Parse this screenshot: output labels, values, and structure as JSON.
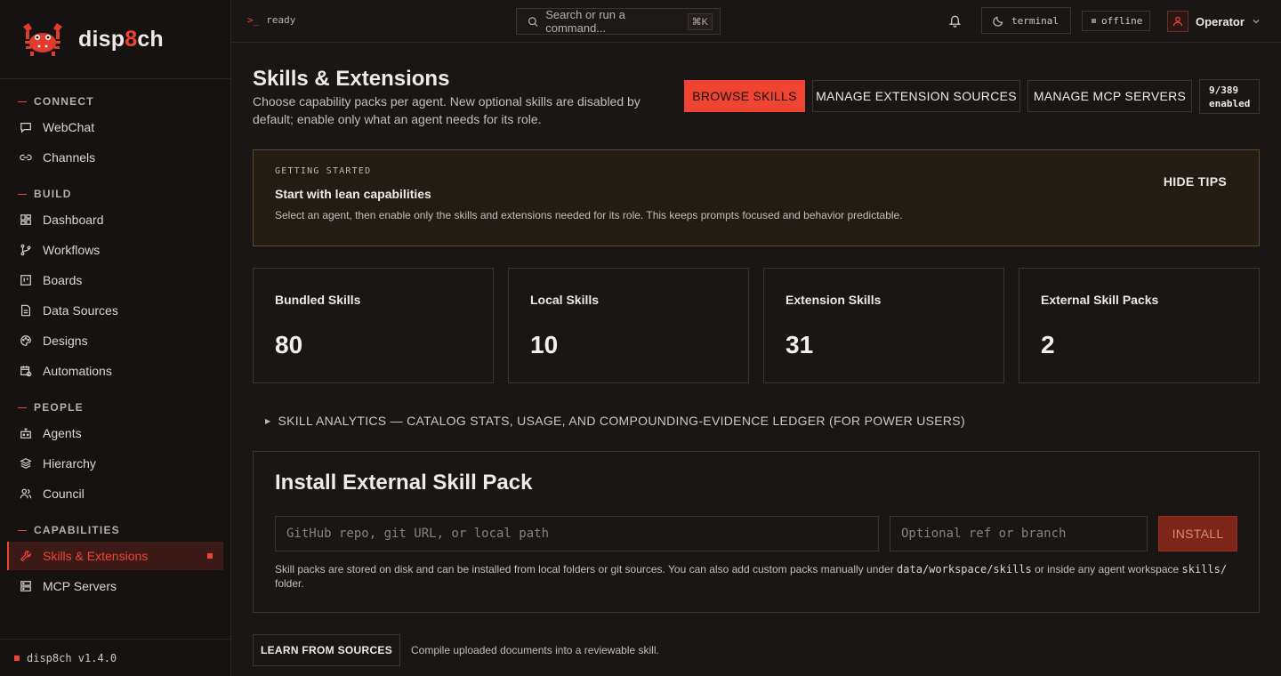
{
  "brand": {
    "name_prefix": "disp",
    "name_accent": "8",
    "name_suffix": "ch",
    "version": "disp8ch v1.4.0"
  },
  "sidebar": {
    "sections": [
      {
        "label": "CONNECT",
        "items": [
          {
            "label": "WebChat",
            "icon": "chat-icon"
          },
          {
            "label": "Channels",
            "icon": "link-icon"
          }
        ]
      },
      {
        "label": "BUILD",
        "items": [
          {
            "label": "Dashboard",
            "icon": "grid-icon"
          },
          {
            "label": "Workflows",
            "icon": "branch-icon"
          },
          {
            "label": "Boards",
            "icon": "board-icon"
          },
          {
            "label": "Data Sources",
            "icon": "file-icon"
          },
          {
            "label": "Designs",
            "icon": "palette-icon"
          },
          {
            "label": "Automations",
            "icon": "calendar-clock-icon"
          }
        ]
      },
      {
        "label": "PEOPLE",
        "items": [
          {
            "label": "Agents",
            "icon": "robot-icon"
          },
          {
            "label": "Hierarchy",
            "icon": "layers-icon"
          },
          {
            "label": "Council",
            "icon": "users-icon"
          }
        ]
      },
      {
        "label": "CAPABILITIES",
        "items": [
          {
            "label": "Skills & Extensions",
            "icon": "wrench-icon",
            "active": true
          },
          {
            "label": "MCP Servers",
            "icon": "server-icon"
          }
        ]
      }
    ]
  },
  "topbar": {
    "status": "ready",
    "search_placeholder": "Search or run a command...",
    "search_shortcut": "⌘K",
    "theme_label": "terminal",
    "connection_label": "offline",
    "user_name": "Operator"
  },
  "page": {
    "title": "Skills & Extensions",
    "subtitle": "Choose capability packs per agent. New optional skills are disabled by default; enable only what an agent needs for its role.",
    "actions": {
      "browse": "BROWSE SKILLS",
      "manage_sources": "MANAGE EXTENSION SOURCES",
      "manage_mcp": "MANAGE MCP SERVERS"
    },
    "enabled_count_top": "9/389",
    "enabled_count_bottom": "enabled"
  },
  "tips": {
    "kicker": "GETTING STARTED",
    "title": "Start with lean capabilities",
    "body": "Select an agent, then enable only the skills and extensions needed for its role. This keeps prompts focused and behavior predictable.",
    "hide_label": "HIDE TIPS"
  },
  "stats": [
    {
      "label": "Bundled Skills",
      "value": "80"
    },
    {
      "label": "Local Skills",
      "value": "10"
    },
    {
      "label": "Extension Skills",
      "value": "31"
    },
    {
      "label": "External Skill Packs",
      "value": "2"
    }
  ],
  "analytics_toggle": "SKILL ANALYTICS — CATALOG STATS, USAGE, AND COMPOUNDING-EVIDENCE LEDGER (FOR POWER USERS)",
  "install": {
    "title": "Install External Skill Pack",
    "source_placeholder": "GitHub repo, git URL, or local path",
    "ref_placeholder": "Optional ref or branch",
    "button": "INSTALL",
    "note_1": "Skill packs are stored on disk and can be installed from local folders or git sources. You can also add custom packs manually under ",
    "note_code_1": "data/workspace/skills",
    "note_2": " or inside any agent workspace ",
    "note_code_2": "skills/",
    "note_3": " folder."
  },
  "learn": {
    "button": "LEARN FROM SOURCES",
    "text": "Compile uploaded documents into a reviewable skill."
  },
  "colors": {
    "accent": "#ef4432",
    "background": "#1a1616",
    "tips_border": "#5e4a2b"
  }
}
